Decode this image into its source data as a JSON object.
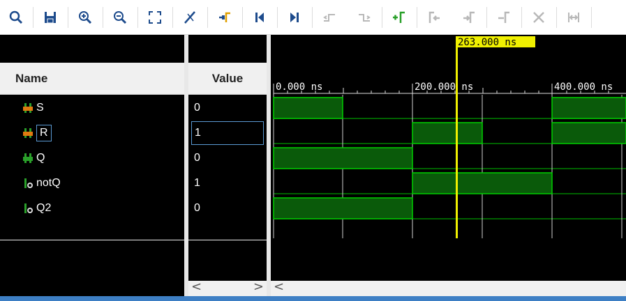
{
  "toolbar": {
    "icons": [
      "zoom-fit-icon",
      "save-icon",
      "zoom-in-icon",
      "zoom-out-icon",
      "full-view-icon",
      "cursor-snap-icon",
      "go-to-cursor-icon",
      "go-to-start-icon",
      "go-to-end-icon",
      "previous-transition-icon",
      "next-transition-icon",
      "add-marker-icon",
      "previous-marker-icon",
      "next-marker-icon",
      "snap-marker-icon",
      "delete-marker-icon",
      "swap-cursors-icon"
    ]
  },
  "names": {
    "header": "Name",
    "signals": [
      {
        "name": "S",
        "icon": "input-bus-icon"
      },
      {
        "name": "R",
        "icon": "input-bus-icon"
      },
      {
        "name": "Q",
        "icon": "output-bus-icon"
      },
      {
        "name": "notQ",
        "icon": "output-port-icon"
      },
      {
        "name": "Q2",
        "icon": "output-port-icon"
      }
    ]
  },
  "values": {
    "header": "Value",
    "items": [
      "0",
      "1",
      "0",
      "1",
      "0"
    ]
  },
  "wave": {
    "cursor_label": "263.000 ns",
    "time_labels": [
      "0.000 ns",
      "200.000 ns",
      "400.000 ns"
    ],
    "waveform_color": "#00d000",
    "fill_color": "#0a5a0a",
    "cursor_color": "#f0f000"
  },
  "scroll": {
    "left_arrow": "<",
    "right_arrow": ">"
  }
}
